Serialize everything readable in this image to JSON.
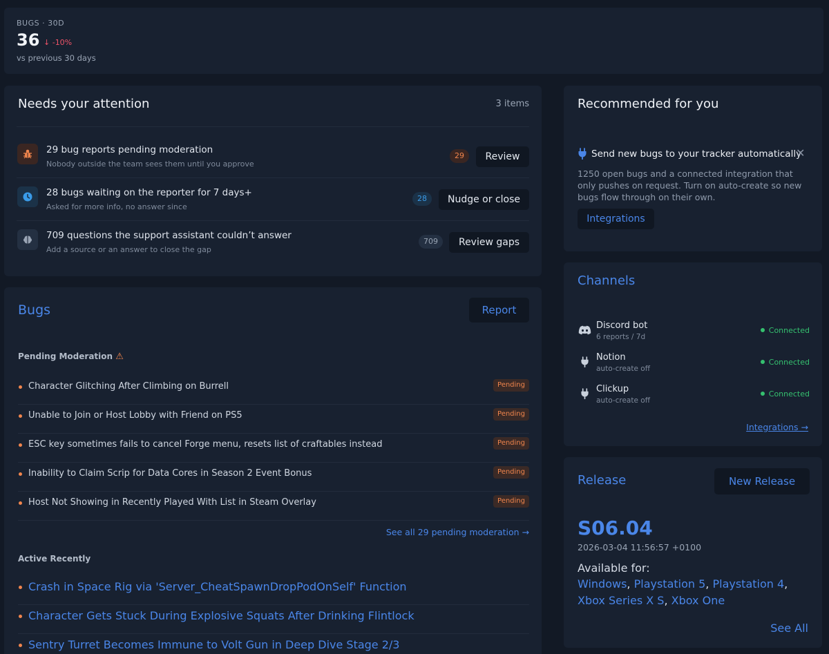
{
  "stats": {
    "label": "BUGS · 30D",
    "value": "36",
    "change": "-10%",
    "subtitle": "vs previous 30 days",
    "change_color": "#f05468"
  },
  "attention": {
    "title": "Needs your attention",
    "count": "3 items",
    "items": [
      {
        "icon": "bug-icon",
        "title": "29 bug reports pending moderation",
        "subtitle": "Nobody outside the team sees them until you approve",
        "badge": "29",
        "action": "Review"
      },
      {
        "icon": "clock-icon",
        "title": "28 bugs waiting on the reporter for 7 days+",
        "subtitle": "Asked for more info, no answer since",
        "badge": "28",
        "action": "Nudge or close"
      },
      {
        "icon": "brain-icon",
        "title": "709 questions the support assistant couldn’t answer",
        "subtitle": "Add a source or an answer to close the gap",
        "badge": "709",
        "action": "Review gaps"
      }
    ]
  },
  "bugs": {
    "title": "Bugs",
    "report_label": "Report",
    "pending_label": "Pending Moderation",
    "pending_items": [
      {
        "title": "Character Glitching After Climbing on Burrell",
        "status": "Pending"
      },
      {
        "title": "Unable to Join or Host Lobby with Friend on PS5",
        "status": "Pending"
      },
      {
        "title": "ESC key sometimes fails to cancel Forge menu, resets list of craftables instead",
        "status": "Pending"
      },
      {
        "title": "Inability to Claim Scrip for Data Cores in Season 2 Event Bonus",
        "status": "Pending"
      },
      {
        "title": "Host Not Showing in Recently Played With List in Steam Overlay",
        "status": "Pending"
      }
    ],
    "see_all_pending": "See all 29 pending moderation →",
    "active_label": "Active Recently",
    "active_items": [
      "Crash in Space Rig via 'Server_CheatSpawnDropPodOnSelf' Function",
      "Character Gets Stuck During Explosive Squats After Drinking Flintlock",
      "Sentry Turret Becomes Immune to Volt Gun in Deep Dive Stage 2/3"
    ]
  },
  "recommended": {
    "title": "Recommended for you",
    "item_title": "Send new bugs to your tracker automatically",
    "item_body": "1250 open bugs and a connected integration that only pushes on request. Turn on auto-create so new bugs flow through on their own.",
    "close_symbol": "✕",
    "button": "Integrations"
  },
  "channels": {
    "title": "Channels",
    "items": [
      {
        "icon": "discord-icon",
        "name": "Discord bot",
        "sub": "6 reports / 7d",
        "status": "Connected"
      },
      {
        "icon": "plug-icon",
        "name": "Notion",
        "sub": "auto-create off",
        "status": "Connected"
      },
      {
        "icon": "plug-icon",
        "name": "Clickup",
        "sub": "auto-create off",
        "status": "Connected"
      }
    ],
    "link": "Integrations →"
  },
  "release": {
    "title": "Release",
    "new_button": "New Release",
    "version": "S06.04",
    "date": "2026-03-04 11:56:57 +0100",
    "available_label": "Available for:",
    "platforms": [
      "Windows",
      "Playstation 5",
      "Playstation 4",
      "Xbox Series X S",
      "Xbox One"
    ],
    "see_all": "See All"
  },
  "colors": {
    "accent": "#4a86e8",
    "pending": "#f0854d",
    "connected": "#35c06f",
    "background": "#121925",
    "card": "#182130"
  }
}
